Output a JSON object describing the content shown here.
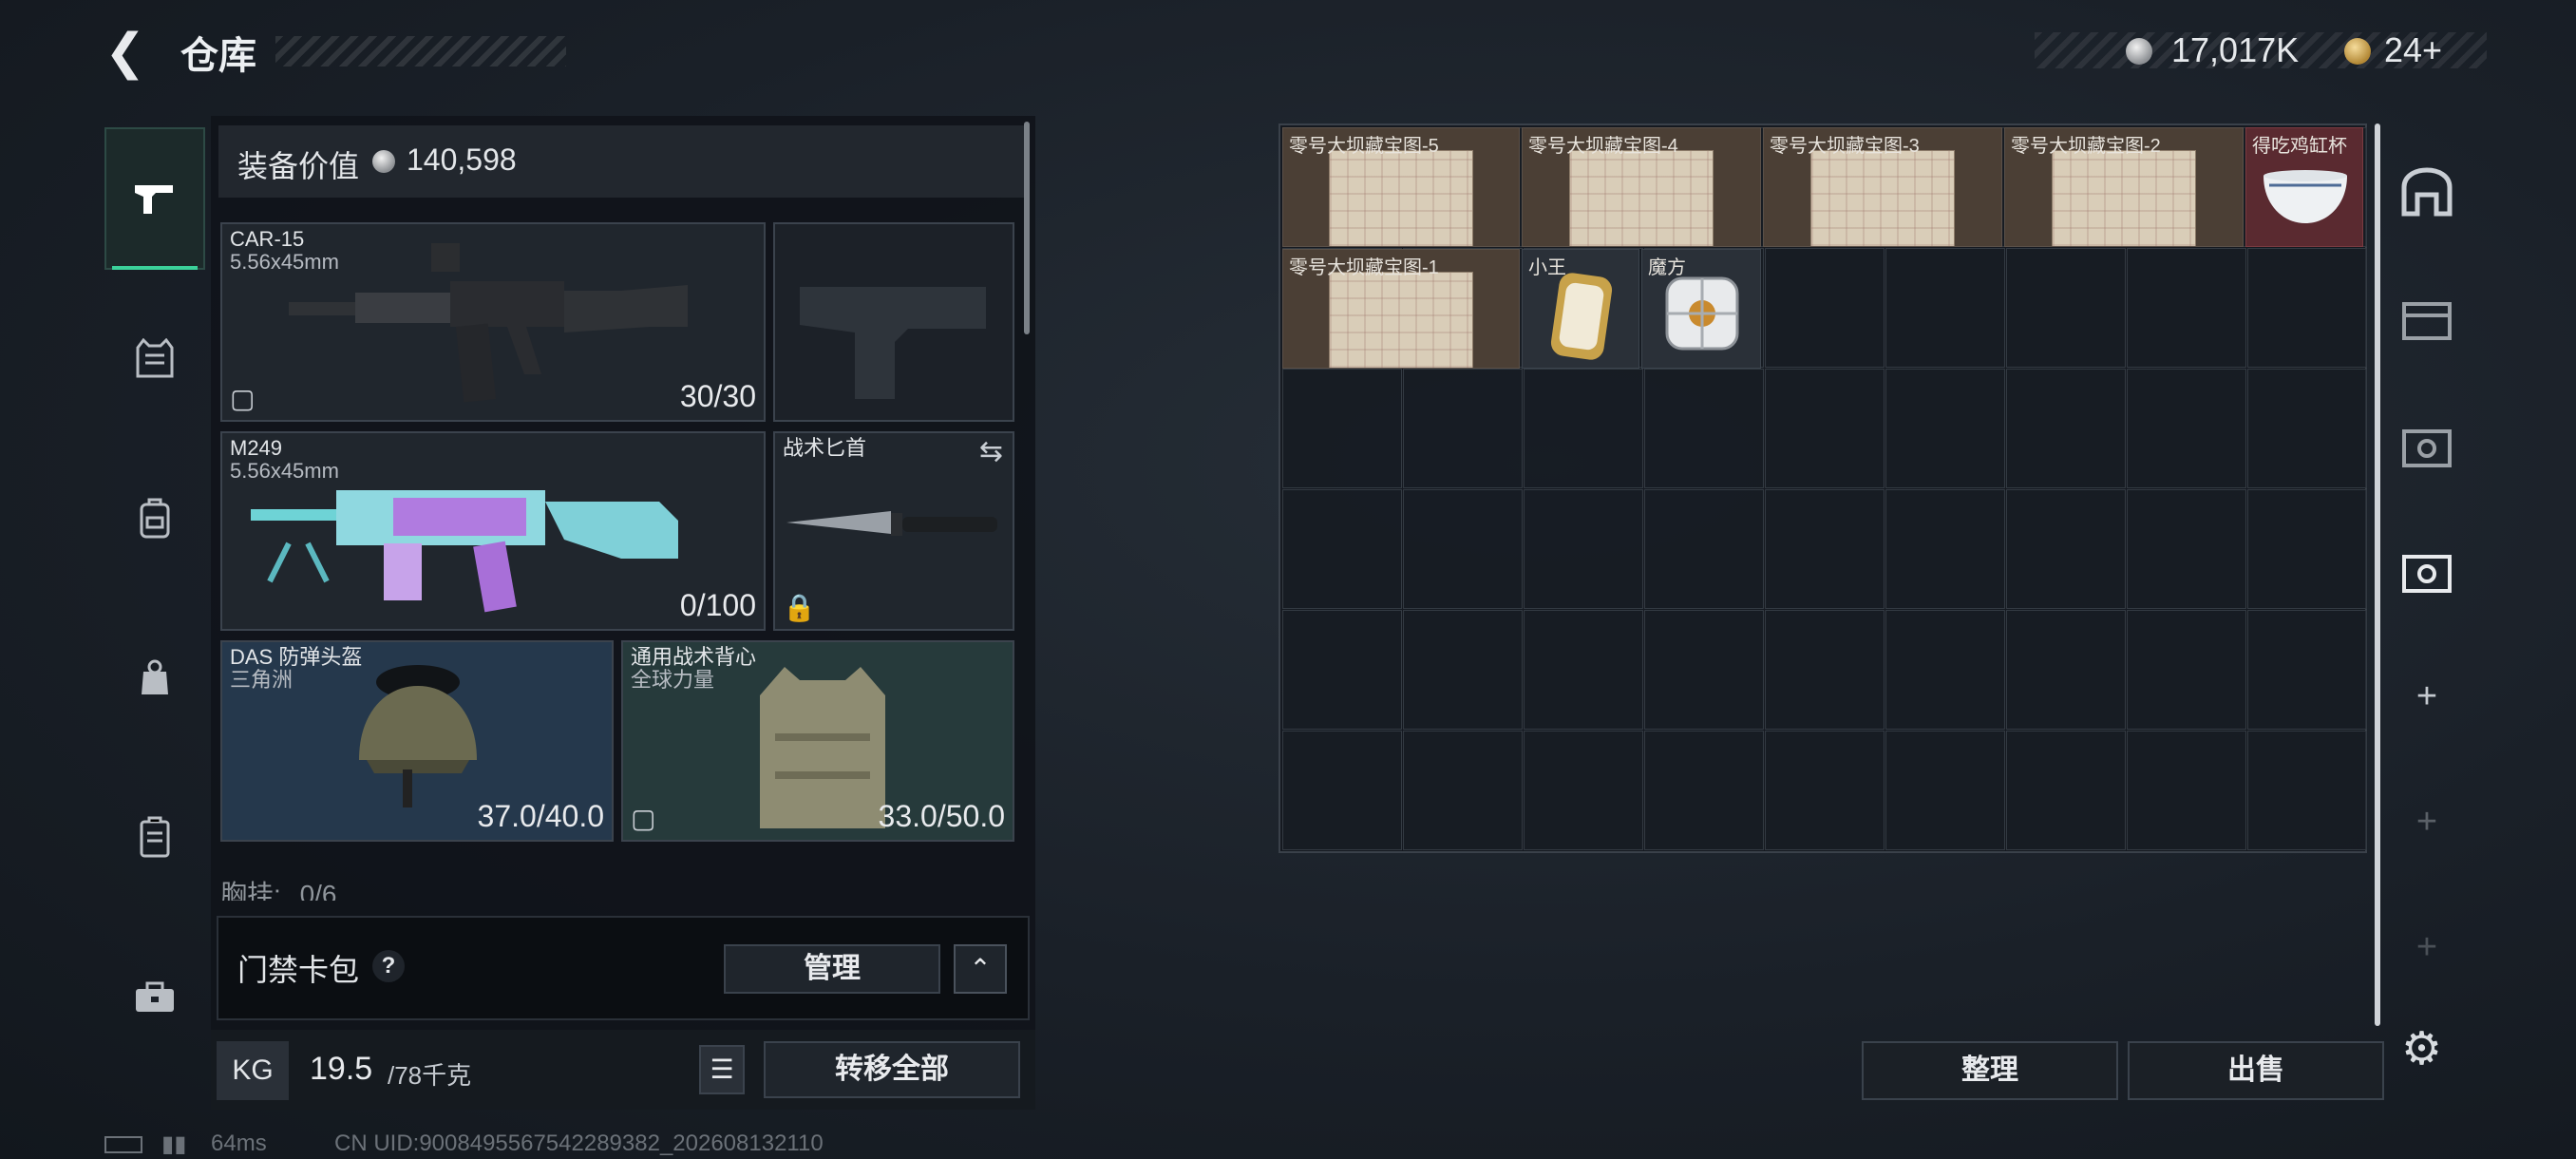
{
  "header": {
    "title": "仓库",
    "silver_amount": "17,017K",
    "gold_amount": "24+"
  },
  "equipment": {
    "value_label": "装备价值",
    "value": "140,598",
    "primary_weapon": {
      "name": "CAR-15",
      "caliber": "5.56x45mm",
      "ammo": "30/30"
    },
    "secondary_weapon": {
      "name": "M249",
      "caliber": "5.56x45mm",
      "ammo": "0/100"
    },
    "melee": {
      "name": "战术匕首"
    },
    "helmet": {
      "name": "DAS 防弹头盔",
      "brand": "三角洲",
      "durability": "37.0/40.0"
    },
    "vest": {
      "name": "通用战术背心",
      "brand": "全球力量",
      "durability": "33.0/50.0"
    },
    "chest_rig_label": "胸挂:",
    "chest_rig_count": "0/6"
  },
  "keycard": {
    "label": "门禁卡包",
    "help": "?",
    "manage_label": "管理"
  },
  "weight": {
    "icon_label": "KG",
    "current": "19.5",
    "max": "/78千克"
  },
  "transfer_all_label": "转移全部",
  "status": {
    "ping": "64ms",
    "uid": "CN UID:9008495567542289382_202608132110"
  },
  "storage": {
    "items": [
      {
        "label": "零号大坝藏宝图-5"
      },
      {
        "label": "零号大坝藏宝图-4"
      },
      {
        "label": "零号大坝藏宝图-3"
      },
      {
        "label": "零号大坝藏宝图-2"
      },
      {
        "label": "得吃鸡缸杯"
      },
      {
        "label": "零号大坝藏宝图-1"
      },
      {
        "label": "小王"
      },
      {
        "label": "魔方"
      }
    ],
    "sort_label": "整理",
    "sell_label": "出售"
  },
  "colors": {
    "accent": "#3bd19a",
    "legendary_bg": "#5a2a30",
    "rare_bg": "#4b3f35"
  }
}
